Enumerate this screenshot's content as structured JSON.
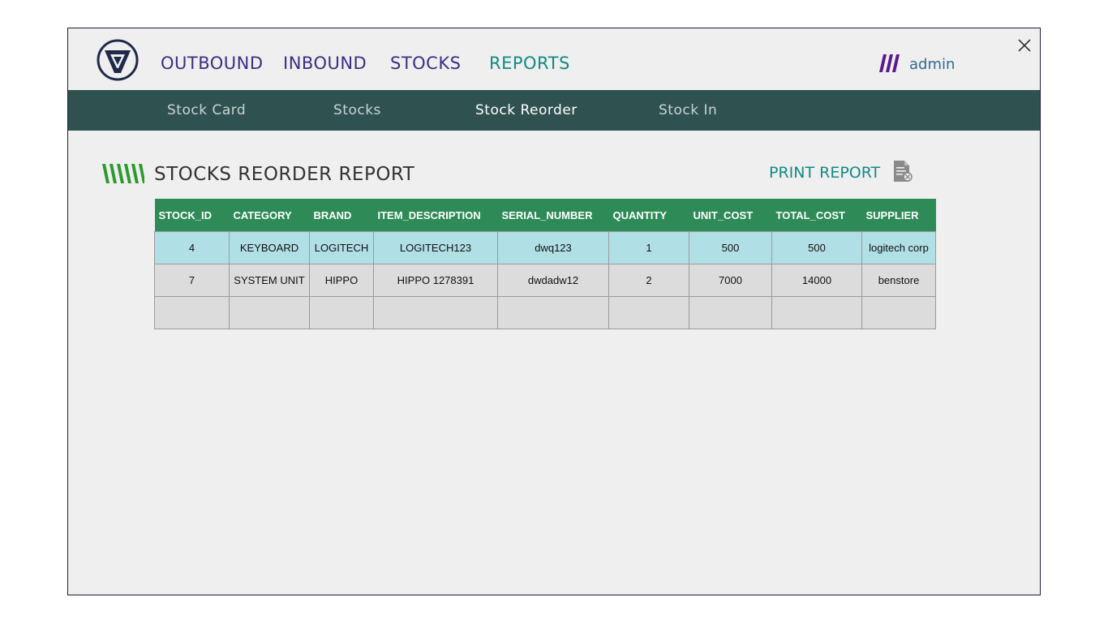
{
  "nav": {
    "items": [
      {
        "label": "OUTBOUND"
      },
      {
        "label": "INBOUND"
      },
      {
        "label": "STOCKS"
      },
      {
        "label": "REPORTS"
      }
    ],
    "active": "REPORTS",
    "user": "admin"
  },
  "subnav": {
    "items": [
      {
        "label": "Stock Card"
      },
      {
        "label": "Stocks"
      },
      {
        "label": "Stock Reorder"
      },
      {
        "label": "Stock In"
      }
    ],
    "active": "Stock Reorder"
  },
  "page": {
    "title": "STOCKS REORDER REPORT",
    "print_label": "PRINT REPORT"
  },
  "table": {
    "columns": [
      "STOCK_ID",
      "CATEGORY",
      "BRAND",
      "ITEM_DESCRIPTION",
      "SERIAL_NUMBER",
      "QUANTITY",
      "UNIT_COST",
      "TOTAL_COST",
      "SUPPLIER"
    ],
    "rows": [
      [
        "4",
        "KEYBOARD",
        "LOGITECH",
        "LOGITECH123",
        "dwq123",
        "1",
        "500",
        "500",
        "logitech corp"
      ],
      [
        "7",
        "SYSTEM UNIT",
        "HIPPO",
        "HIPPO 1278391",
        "dwdadw12",
        "2",
        "7000",
        "14000",
        "benstore"
      ],
      [
        "",
        "",
        "",
        "",
        "",
        "",
        "",
        "",
        ""
      ]
    ]
  },
  "colors": {
    "nav_text": "#3b2f82",
    "nav_active": "#138a84",
    "subbar_bg": "#2f5250",
    "header_bg": "#2e8b57",
    "selected_row": "#b0dfe5",
    "row_bg": "#dcdcdc"
  }
}
